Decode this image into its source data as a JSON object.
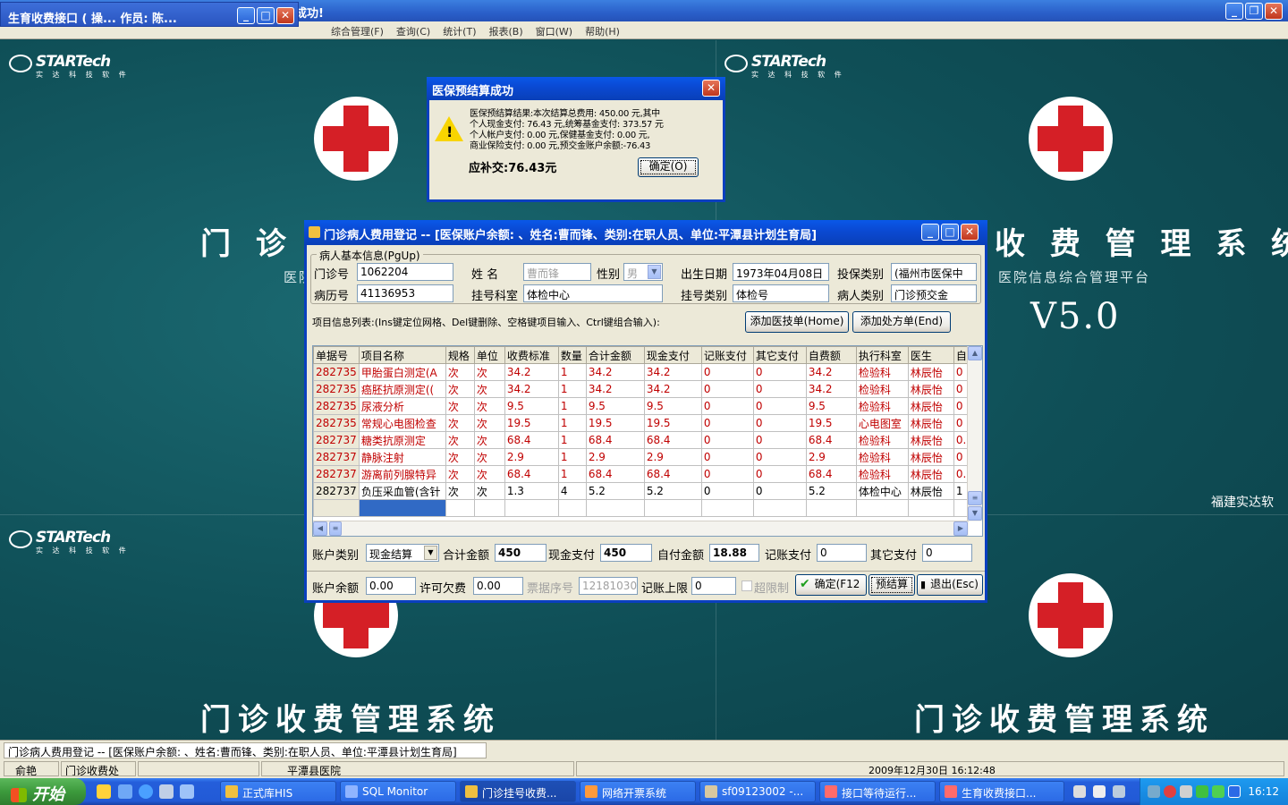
{
  "app_window": {
    "title": "成功!",
    "controls": [
      "_",
      "❐",
      "✕"
    ]
  },
  "mini_window": {
    "title": "生育收费接口 ( 操...   作员: 陈..."
  },
  "menubar": {
    "items": [
      "综合管理(F)",
      "查询(C)",
      "统计(T)",
      "报表(B)",
      "窗口(W)",
      "帮助(H)"
    ]
  },
  "desktop": {
    "logo_text": "STARTech",
    "logo_sub": "实 达 科 技 软 件",
    "system_title": "门诊收费管理系统",
    "system_title_partial": "门 诊 收",
    "right_title": "收 费 管 理 系 统",
    "platform_subtitle": "医院信息综合管理平台",
    "platform_subtitle_partial": "医院",
    "version": "V5.0",
    "company": "福建实达软"
  },
  "message_dialog": {
    "title": "医保预结算成功",
    "icon": "warning-icon",
    "lines": [
      "医保预结算结果:本次结算总费用: 450.00 元,其中",
      "个人现金支付: 76.43 元,统筹基金支付: 373.57 元",
      " 个人帐户支付: 0.00 元,保健基金支付: 0.00 元,",
      "商业保险支付: 0.00 元,预交金账户余额:-76.43"
    ],
    "amount_due": "应补交:76.43元",
    "ok_label": "确定(O)"
  },
  "main_dialog": {
    "title": "门诊病人费用登记 -- [医保账户余额: 、姓名:曹而锋、类别:在职人员、单位:平潭县计划生育局]",
    "patient_group": {
      "legend": "病人基本信息(PgUp)",
      "clinic_no_label": "门诊号",
      "clinic_no": "1062204",
      "name_label": "姓    名",
      "name": "曹而锋",
      "gender_label": "性别",
      "gender": "男",
      "birth_label": "出生日期",
      "birth": "1973年04月08日",
      "insurance_label": "投保类别",
      "insurance": "(福州市医保中",
      "record_no_label": "病历号",
      "record_no": "41136953",
      "dept_label": "挂号科室",
      "dept": "体检中心",
      "reg_type_label": "挂号类别",
      "reg_type": "体检号",
      "patient_type_label": "病人类别",
      "patient_type": "门诊预交金"
    },
    "items_hint": "项目信息列表:(Ins键定位网格、Del键删除、空格键项目输入、Ctrl键组合输入):",
    "add_tech_label": "添加医技单(Home)",
    "add_rx_label": "添加处方单(End)",
    "grid": {
      "headers": [
        "单据号",
        "项目名称",
        "规格",
        "单位",
        "收费标准",
        "数量",
        "合计金额",
        "现金支付",
        "记账支付",
        "其它支付",
        "自费额",
        "执行科室",
        "医生",
        "自"
      ],
      "rows": [
        [
          "282735",
          "甲胎蛋白测定(A",
          "次",
          "次",
          "34.2",
          "1",
          "34.2",
          "34.2",
          "0",
          "0",
          "34.2",
          "检验科",
          "林辰怡",
          "0"
        ],
        [
          "282735",
          "癌胚抗原测定((",
          "次",
          "次",
          "34.2",
          "1",
          "34.2",
          "34.2",
          "0",
          "0",
          "34.2",
          "检验科",
          "林辰怡",
          "0"
        ],
        [
          "282735",
          "尿液分析",
          "次",
          "次",
          "9.5",
          "1",
          "9.5",
          "9.5",
          "0",
          "0",
          "9.5",
          "检验科",
          "林辰怡",
          "0"
        ],
        [
          "282735",
          "常规心电图检查",
          "次",
          "次",
          "19.5",
          "1",
          "19.5",
          "19.5",
          "0",
          "0",
          "19.5",
          "心电图室",
          "林辰怡",
          "0"
        ],
        [
          "282737",
          "糖类抗原测定",
          "次",
          "次",
          "68.4",
          "1",
          "68.4",
          "68.4",
          "0",
          "0",
          "68.4",
          "检验科",
          "林辰怡",
          "0."
        ],
        [
          "282737",
          "静脉注射",
          "次",
          "次",
          "2.9",
          "1",
          "2.9",
          "2.9",
          "0",
          "0",
          "2.9",
          "检验科",
          "林辰怡",
          "0"
        ],
        [
          "282737",
          "游离前列腺特异",
          "次",
          "次",
          "68.4",
          "1",
          "68.4",
          "68.4",
          "0",
          "0",
          "68.4",
          "检验科",
          "林辰怡",
          "0."
        ],
        [
          "282737",
          "负压采血管(含针",
          "次",
          "次",
          "1.3",
          "4",
          "5.2",
          "5.2",
          "0",
          "0",
          "5.2",
          "体检中心",
          "林辰怡",
          "1"
        ]
      ]
    },
    "footer": {
      "account_type_label": "账户类别",
      "account_type": "现金结算",
      "total_label": "合计金额",
      "total": "450",
      "cash_label": "现金支付",
      "cash": "450",
      "self_label": "自付金额",
      "self": "18.88",
      "credit_label": "记账支付",
      "credit": "0",
      "other_label": "其它支付",
      "other": "0",
      "balance_label": "账户余额",
      "balance": "0.00",
      "allow_debt_label": "许可欠费",
      "allow_debt": "0.00",
      "receipt_label": "票据序号",
      "receipt": "12181030",
      "credit_limit_label": "记账上限",
      "credit_limit": "0",
      "over_limit_label": "超限制",
      "confirm_label": "确定(F12",
      "presettle_label": "预结算",
      "exit_label": "退出(Esc)"
    }
  },
  "status_bar": {
    "message": "门诊病人费用登记 -- [医保账户余额: 、姓名:曹而锋、类别:在职人员、单位:平潭县计划生育局]",
    "user": "俞艳",
    "office": "门诊收费处",
    "hospital": "平潭县医院",
    "datetime": "2009年12月30日  16:12:48"
  },
  "taskbar": {
    "start_label": "开始",
    "tasks": [
      "正式库HIS",
      "SQL Monitor",
      "门诊挂号收费...",
      "网络开票系统",
      "sf09123002 -...",
      "接口等待运行...",
      "生育收费接口..."
    ],
    "clock": "16:12"
  },
  "colors": {
    "desktop_bg": "#0e4d55",
    "titlebar_blue": "#0a4ad4",
    "red_text": "#c00000",
    "warning_yellow": "#f8d400"
  }
}
